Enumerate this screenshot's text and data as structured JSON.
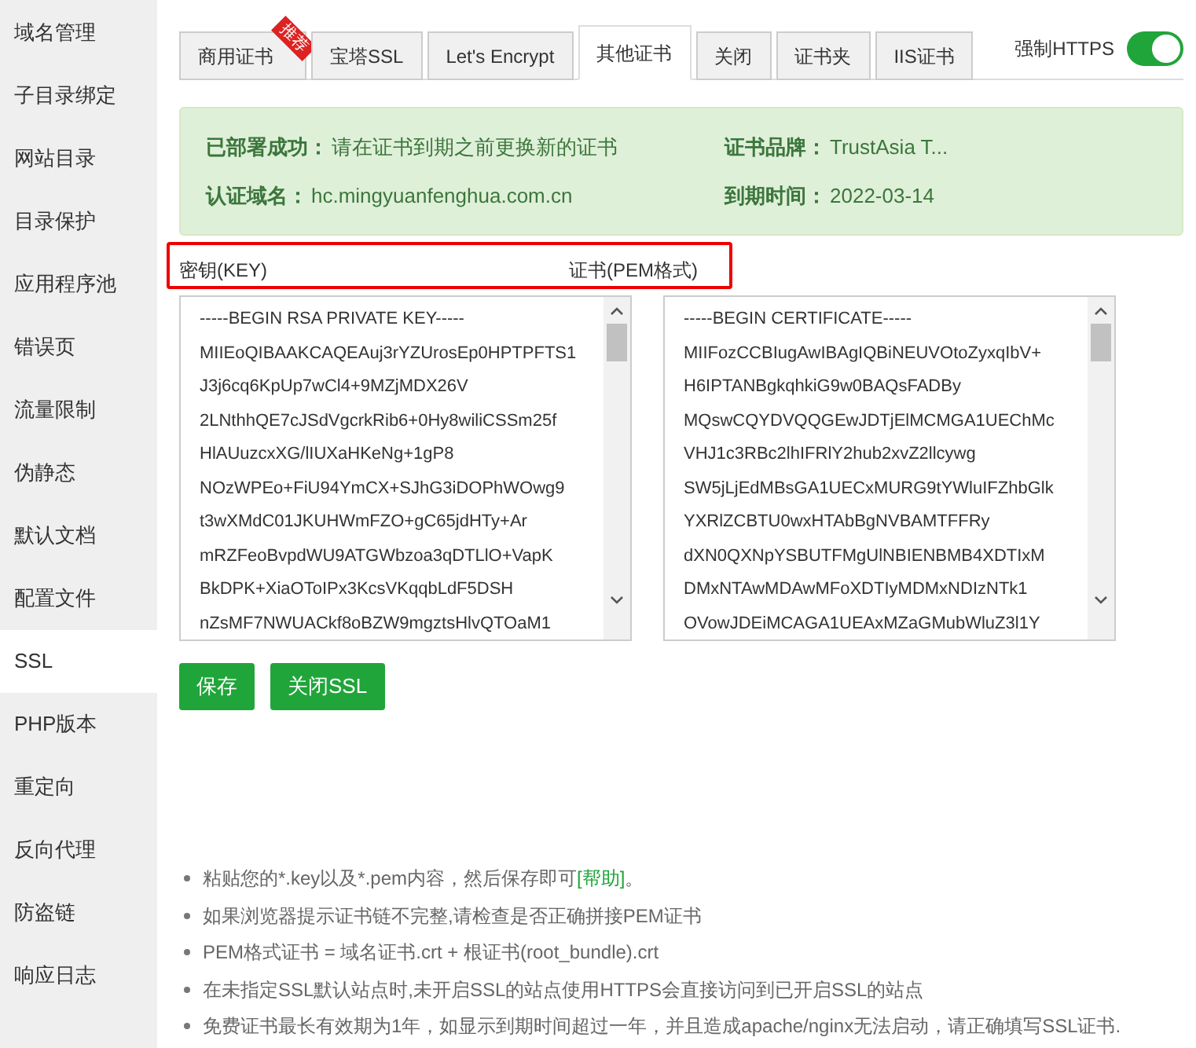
{
  "sidebar": {
    "items": [
      {
        "label": "域名管理",
        "selected": false
      },
      {
        "label": "子目录绑定",
        "selected": false
      },
      {
        "label": "网站目录",
        "selected": false
      },
      {
        "label": "目录保护",
        "selected": false
      },
      {
        "label": "应用程序池",
        "selected": false
      },
      {
        "label": "错误页",
        "selected": false
      },
      {
        "label": "流量限制",
        "selected": false
      },
      {
        "label": "伪静态",
        "selected": false
      },
      {
        "label": "默认文档",
        "selected": false
      },
      {
        "label": "配置文件",
        "selected": false
      },
      {
        "label": "SSL",
        "selected": true
      },
      {
        "label": "PHP版本",
        "selected": false
      },
      {
        "label": "重定向",
        "selected": false
      },
      {
        "label": "反向代理",
        "selected": false
      },
      {
        "label": "防盗链",
        "selected": false
      },
      {
        "label": "响应日志",
        "selected": false
      }
    ]
  },
  "tabs": [
    {
      "label": "商用证书",
      "selected": false,
      "ribbon": "推荐"
    },
    {
      "label": "宝塔SSL",
      "selected": false
    },
    {
      "label": "Let's Encrypt",
      "selected": false
    },
    {
      "label": "其他证书",
      "selected": true
    },
    {
      "label": "关闭",
      "selected": false
    },
    {
      "label": "证书夹",
      "selected": false
    },
    {
      "label": "IIS证书",
      "selected": false
    }
  ],
  "force_https": {
    "label": "强制HTTPS",
    "on": true
  },
  "status": {
    "fields": [
      {
        "label": "已部署成功：",
        "value": "请在证书到期之前更换新的证书"
      },
      {
        "label": "证书品牌：",
        "value": "TrustAsia T..."
      },
      {
        "label": "认证域名：",
        "value": "hc.mingyuanfenghua.com.cn"
      },
      {
        "label": "到期时间：",
        "value": "2022-03-14"
      }
    ]
  },
  "highlight": true,
  "key": {
    "label": "密钥(KEY)",
    "lines": [
      "-----BEGIN RSA PRIVATE KEY-----",
      "MIIEoQIBAAKCAQEAuj3rYZUrosEp0HPTPFTS1",
      "J3j6cq6KpUp7wCl4+9MZjMDX26V",
      "2LNthhQE7cJSdVgcrkRib6+0Hy8wiliCSSm25f",
      "HlAUuzcxXG/lIUXaHKeNg+1gP8",
      "NOzWPEo+FiU94YmCX+SJhG3iDOPhWOwg9",
      "t3wXMdC01JKUHWmFZO+gC65jdHTy+Ar",
      "mRZFeoBvpdWU9ATGWbzoa3qDTLlO+VapK",
      "BkDPK+XiaOToIPx3KcsVKqqbLdF5DSH",
      "nZsMF7NWUACkf8oBZW9mgztsHlvQTOaM1"
    ]
  },
  "cert": {
    "label": "证书(PEM格式)",
    "lines": [
      "-----BEGIN CERTIFICATE-----",
      "MIIFozCCBIugAwIBAgIQBiNEUVOtoZyxqIbV+",
      "H6IPTANBgkqhkiG9w0BAQsFADBy",
      "MQswCQYDVQQGEwJDTjElMCMGA1UEChMc",
      "VHJ1c3RBc2lhIFRlY2hub2xvZ2llcywg",
      "SW5jLjEdMBsGA1UECxMURG9tYWluIFZhbGlk",
      "YXRlZCBTU0wxHTAbBgNVBAMTFFRy",
      "dXN0QXNpYSBUTFMgUlNBIENBMB4XDTIxM",
      "DMxNTAwMDAwMFoXDTIyMDMxNDIzNTk1",
      "OVowJDEiMCAGA1UEAxMZaGMubWluZ3l1Y"
    ]
  },
  "buttons": [
    "保存",
    "关闭SSL"
  ],
  "notes": [
    "粘贴您的*.key以及*.pem内容，然后保存即可",
    "如果浏览器提示证书链不完整,请检查是否正确拼接PEM证书",
    "PEM格式证书 = 域名证书.crt + 根证书(root_bundle).crt",
    "在未指定SSL默认站点时,未开启SSL的站点使用HTTPS会直接访问到已开启SSL的站点",
    "免费证书最长有效期为1年，如显示到期时间超过一年，并且造成apache/nginx无法启动，请正确填写SSL证书."
  ],
  "help_link": "[帮助]",
  "help_suffix": "。"
}
